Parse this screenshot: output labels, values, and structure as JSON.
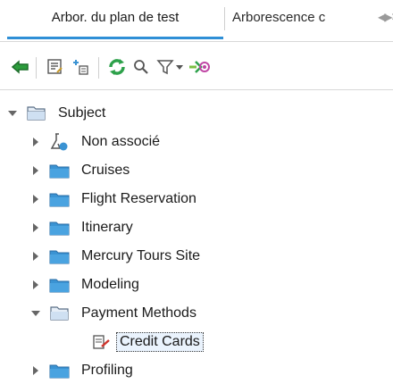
{
  "tabs": [
    {
      "label": "Arbor. du plan de test"
    },
    {
      "label": "Arborescence c"
    }
  ],
  "tree": {
    "root": {
      "label": "Subject"
    },
    "items": [
      {
        "label": "Non associé"
      },
      {
        "label": "Cruises"
      },
      {
        "label": "Flight Reservation"
      },
      {
        "label": "Itinerary"
      },
      {
        "label": "Mercury Tours Site"
      },
      {
        "label": "Modeling"
      },
      {
        "label": "Payment Methods"
      },
      {
        "label": "Credit Cards"
      },
      {
        "label": "Profiling"
      }
    ]
  },
  "colors": {
    "accent": "#2f8fd6",
    "folder": "#3a93d3",
    "refresh": "#2da14a"
  },
  "icons": [
    "back-arrow-icon",
    "new-folder-icon",
    "new-test-icon",
    "refresh-icon",
    "find-icon",
    "filter-icon",
    "go-to-icon"
  ]
}
